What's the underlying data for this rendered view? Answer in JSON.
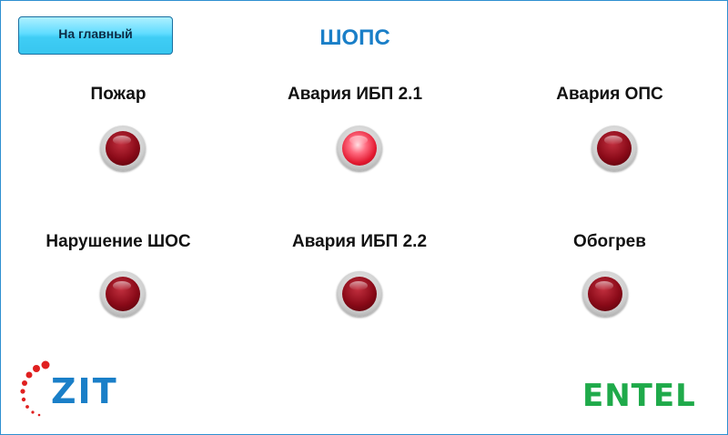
{
  "header": {
    "home_button_label": "На главный",
    "title": "ШОПС"
  },
  "indicators": [
    {
      "label": "Пожар",
      "state": "off"
    },
    {
      "label": "Авария ИБП 2.1",
      "state": "on"
    },
    {
      "label": "Авария ОПС",
      "state": "off"
    },
    {
      "label": "Нарушение ШОС",
      "state": "off"
    },
    {
      "label": "Авария ИБП 2.2",
      "state": "off"
    },
    {
      "label": "Обогрев",
      "state": "off"
    }
  ],
  "logos": {
    "left": "ZIT",
    "right": "ENTEL"
  },
  "colors": {
    "accent_blue": "#1a7fc8",
    "lamp_off": "#8a0a18",
    "lamp_on": "#e2182f",
    "entel_green": "#1faa4a"
  }
}
